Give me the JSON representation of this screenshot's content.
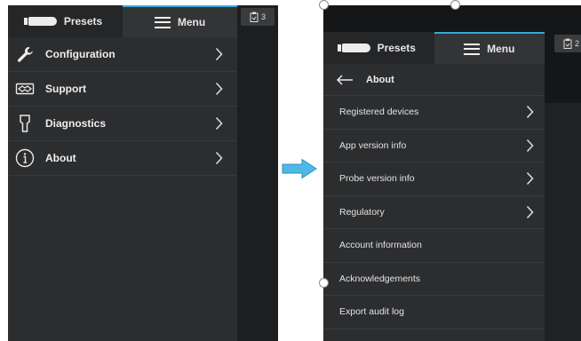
{
  "left": {
    "tabs": {
      "presets": "Presets",
      "menu": "Menu"
    },
    "menu_items": [
      {
        "label": "Configuration",
        "icon": "wrench-icon"
      },
      {
        "label": "Support",
        "icon": "handshake-icon"
      },
      {
        "label": "Diagnostics",
        "icon": "probe-icon"
      },
      {
        "label": "About",
        "icon": "info-icon"
      }
    ],
    "badge": {
      "icon": "clipboard-icon",
      "count": "3"
    }
  },
  "right": {
    "tabs": {
      "presets": "Presets",
      "menu": "Menu"
    },
    "header": {
      "back_icon": "back-arrow-icon",
      "title": "About"
    },
    "items": [
      {
        "label": "Registered devices",
        "has_chevron": true
      },
      {
        "label": "App version info",
        "has_chevron": true
      },
      {
        "label": "Probe version info",
        "has_chevron": true
      },
      {
        "label": "Regulatory",
        "has_chevron": true
      },
      {
        "label": "Account information",
        "has_chevron": false
      },
      {
        "label": "Acknowledgements",
        "has_chevron": false
      },
      {
        "label": "Export audit log",
        "has_chevron": false
      }
    ],
    "badge": {
      "icon": "clipboard-icon",
      "count": "2"
    }
  },
  "colors": {
    "accent": "#38a9d8",
    "arrow": "#4fb8e6",
    "panel": "#2c2d2f",
    "background": "#1d1e1f"
  }
}
